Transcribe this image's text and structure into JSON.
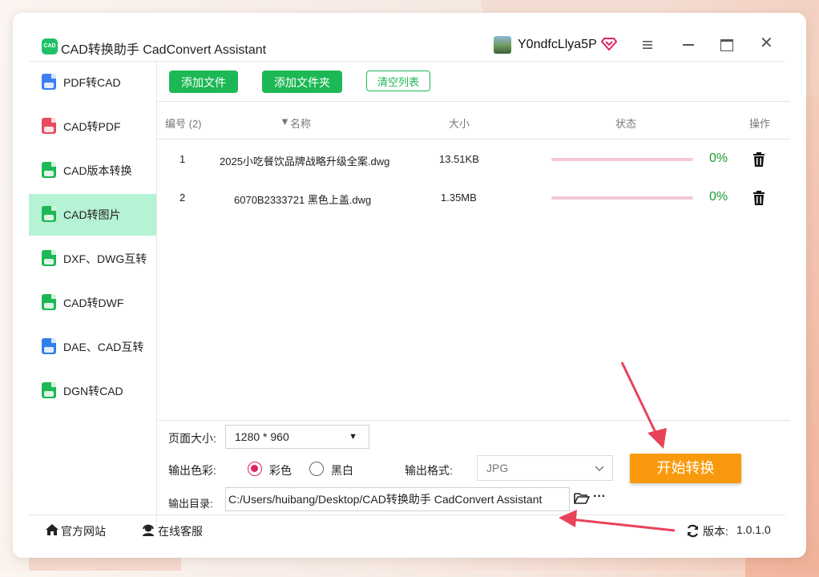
{
  "app": {
    "title": "CAD转换助手 CadConvert Assistant",
    "logo_text": "CAD",
    "username": "Y0ndfcLlya5P"
  },
  "sidebar": {
    "items": [
      {
        "label": "PDF转CAD",
        "icon": "pdf-to-cad-icon",
        "active": false,
        "color": "#3b7ff0"
      },
      {
        "label": "CAD转PDF",
        "icon": "cad-to-pdf-icon",
        "active": false,
        "color": "#e84a5f"
      },
      {
        "label": "CAD版本转换",
        "icon": "cad-version-icon",
        "active": false,
        "color": "#1cb855"
      },
      {
        "label": "CAD转图片",
        "icon": "cad-to-image-icon",
        "active": true,
        "color": "#1cb855"
      },
      {
        "label": "DXF、DWG互转",
        "icon": "dxf-dwg-icon",
        "active": false,
        "color": "#1cb855"
      },
      {
        "label": "CAD转DWF",
        "icon": "cad-to-dwf-icon",
        "active": false,
        "color": "#1cb855"
      },
      {
        "label": "DAE、CAD互转",
        "icon": "dae-cad-icon",
        "active": false,
        "color": "#2f7fe8"
      },
      {
        "label": "DGN转CAD",
        "icon": "dgn-to-cad-icon",
        "active": false,
        "color": "#1cb855"
      }
    ]
  },
  "toolbar": {
    "add_file": "添加文件",
    "add_folder": "添加文件夹",
    "clear_list": "清空列表"
  },
  "table": {
    "headers": {
      "index": "编号 (2)",
      "name": "名称",
      "size": "大小",
      "status": "状态",
      "action": "操作"
    },
    "rows": [
      {
        "index": "1",
        "name": "2025小吃餐饮品牌战略升级全案.dwg",
        "size": "13.51KB",
        "progress": 0,
        "percent": "0%"
      },
      {
        "index": "2",
        "name": "6070B2333721 黑色上盖.dwg",
        "size": "1.35MB",
        "progress": 0,
        "percent": "0%"
      }
    ]
  },
  "options": {
    "page_size_label": "页面大小:",
    "page_size_value": "1280 * 960",
    "color_label": "输出色彩:",
    "color_options": [
      "彩色",
      "黑白"
    ],
    "color_selected": "彩色",
    "format_label": "输出格式:",
    "format_value": "JPG",
    "output_dir_label": "输出目录:",
    "output_dir_value": "C:/Users/huibang/Desktop/CAD转换助手 CadConvert Assistant",
    "start_button": "开始转换"
  },
  "footer": {
    "website": "官方网站",
    "support": "在线客服",
    "version_label": "版本:",
    "version": "1.0.1.0"
  },
  "colors": {
    "accent_green": "#1cb855",
    "start_orange": "#f99a0e",
    "active_bg": "#b6f2d4",
    "annotation_red": "#e8435a"
  }
}
